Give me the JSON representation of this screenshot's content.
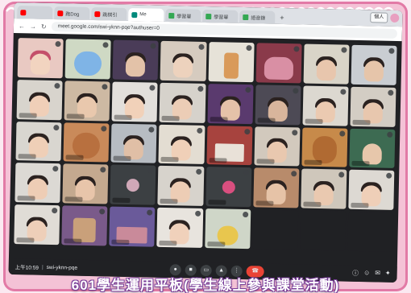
{
  "colors": {
    "frame_pink": "#f4c2d6",
    "frame_border": "#e27aa6",
    "meet_bg": "#202124",
    "end_call_red": "#ea4335",
    "caption_outline": "#7a3f9a"
  },
  "browser": {
    "tabs": [
      {
        "label": "",
        "favicon": "youtube",
        "active": false
      },
      {
        "label": "跑Dog",
        "favicon": "youtube",
        "active": false
      },
      {
        "label": "跳棋引",
        "favicon": "youtube",
        "active": false
      },
      {
        "label": "Me",
        "favicon": "meet",
        "active": true
      },
      {
        "label": "學習單",
        "favicon": "google-drive",
        "active": false
      },
      {
        "label": "學習單",
        "favicon": "google-drive",
        "active": false
      },
      {
        "label": "語音錄",
        "favicon": "google-drive",
        "active": false
      }
    ],
    "new_tab_icon": "plus-icon",
    "avatar_chip": "個人",
    "url": "meet.google.com/swi-yknn-pqe?authuser=0"
  },
  "meeting": {
    "time": "上午10:59",
    "code": "swi-yknn-pqe",
    "controls": [
      "mic-icon",
      "camera-icon",
      "captions-icon",
      "present-icon",
      "more-icon",
      "end-call-icon"
    ],
    "right_controls": [
      "info-icon",
      "people-icon",
      "chat-icon",
      "activities-icon"
    ]
  },
  "caption": "601學生運用平板(學生線上參與課堂活動)"
}
